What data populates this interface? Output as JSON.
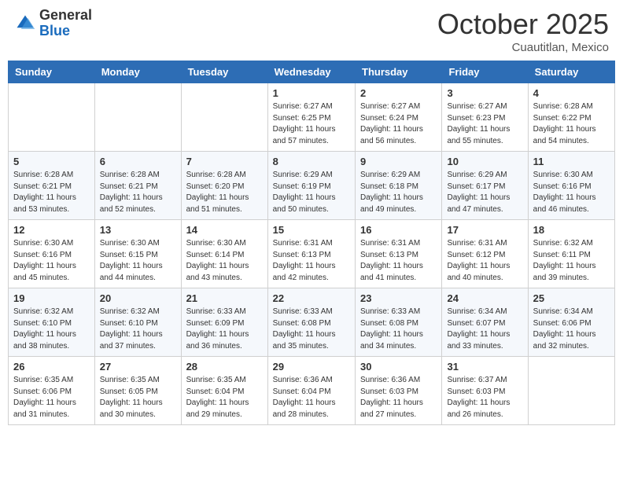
{
  "header": {
    "logo_general": "General",
    "logo_blue": "Blue",
    "month_title": "October 2025",
    "location": "Cuautitlan, Mexico"
  },
  "days_of_week": [
    "Sunday",
    "Monday",
    "Tuesday",
    "Wednesday",
    "Thursday",
    "Friday",
    "Saturday"
  ],
  "weeks": [
    [
      {
        "day": null
      },
      {
        "day": null
      },
      {
        "day": null
      },
      {
        "day": "1",
        "sunrise": "6:27 AM",
        "sunset": "6:25 PM",
        "daylight": "11 hours and 57 minutes."
      },
      {
        "day": "2",
        "sunrise": "6:27 AM",
        "sunset": "6:24 PM",
        "daylight": "11 hours and 56 minutes."
      },
      {
        "day": "3",
        "sunrise": "6:27 AM",
        "sunset": "6:23 PM",
        "daylight": "11 hours and 55 minutes."
      },
      {
        "day": "4",
        "sunrise": "6:28 AM",
        "sunset": "6:22 PM",
        "daylight": "11 hours and 54 minutes."
      }
    ],
    [
      {
        "day": "5",
        "sunrise": "6:28 AM",
        "sunset": "6:21 PM",
        "daylight": "11 hours and 53 minutes."
      },
      {
        "day": "6",
        "sunrise": "6:28 AM",
        "sunset": "6:21 PM",
        "daylight": "11 hours and 52 minutes."
      },
      {
        "day": "7",
        "sunrise": "6:28 AM",
        "sunset": "6:20 PM",
        "daylight": "11 hours and 51 minutes."
      },
      {
        "day": "8",
        "sunrise": "6:29 AM",
        "sunset": "6:19 PM",
        "daylight": "11 hours and 50 minutes."
      },
      {
        "day": "9",
        "sunrise": "6:29 AM",
        "sunset": "6:18 PM",
        "daylight": "11 hours and 49 minutes."
      },
      {
        "day": "10",
        "sunrise": "6:29 AM",
        "sunset": "6:17 PM",
        "daylight": "11 hours and 47 minutes."
      },
      {
        "day": "11",
        "sunrise": "6:30 AM",
        "sunset": "6:16 PM",
        "daylight": "11 hours and 46 minutes."
      }
    ],
    [
      {
        "day": "12",
        "sunrise": "6:30 AM",
        "sunset": "6:16 PM",
        "daylight": "11 hours and 45 minutes."
      },
      {
        "day": "13",
        "sunrise": "6:30 AM",
        "sunset": "6:15 PM",
        "daylight": "11 hours and 44 minutes."
      },
      {
        "day": "14",
        "sunrise": "6:30 AM",
        "sunset": "6:14 PM",
        "daylight": "11 hours and 43 minutes."
      },
      {
        "day": "15",
        "sunrise": "6:31 AM",
        "sunset": "6:13 PM",
        "daylight": "11 hours and 42 minutes."
      },
      {
        "day": "16",
        "sunrise": "6:31 AM",
        "sunset": "6:13 PM",
        "daylight": "11 hours and 41 minutes."
      },
      {
        "day": "17",
        "sunrise": "6:31 AM",
        "sunset": "6:12 PM",
        "daylight": "11 hours and 40 minutes."
      },
      {
        "day": "18",
        "sunrise": "6:32 AM",
        "sunset": "6:11 PM",
        "daylight": "11 hours and 39 minutes."
      }
    ],
    [
      {
        "day": "19",
        "sunrise": "6:32 AM",
        "sunset": "6:10 PM",
        "daylight": "11 hours and 38 minutes."
      },
      {
        "day": "20",
        "sunrise": "6:32 AM",
        "sunset": "6:10 PM",
        "daylight": "11 hours and 37 minutes."
      },
      {
        "day": "21",
        "sunrise": "6:33 AM",
        "sunset": "6:09 PM",
        "daylight": "11 hours and 36 minutes."
      },
      {
        "day": "22",
        "sunrise": "6:33 AM",
        "sunset": "6:08 PM",
        "daylight": "11 hours and 35 minutes."
      },
      {
        "day": "23",
        "sunrise": "6:33 AM",
        "sunset": "6:08 PM",
        "daylight": "11 hours and 34 minutes."
      },
      {
        "day": "24",
        "sunrise": "6:34 AM",
        "sunset": "6:07 PM",
        "daylight": "11 hours and 33 minutes."
      },
      {
        "day": "25",
        "sunrise": "6:34 AM",
        "sunset": "6:06 PM",
        "daylight": "11 hours and 32 minutes."
      }
    ],
    [
      {
        "day": "26",
        "sunrise": "6:35 AM",
        "sunset": "6:06 PM",
        "daylight": "11 hours and 31 minutes."
      },
      {
        "day": "27",
        "sunrise": "6:35 AM",
        "sunset": "6:05 PM",
        "daylight": "11 hours and 30 minutes."
      },
      {
        "day": "28",
        "sunrise": "6:35 AM",
        "sunset": "6:04 PM",
        "daylight": "11 hours and 29 minutes."
      },
      {
        "day": "29",
        "sunrise": "6:36 AM",
        "sunset": "6:04 PM",
        "daylight": "11 hours and 28 minutes."
      },
      {
        "day": "30",
        "sunrise": "6:36 AM",
        "sunset": "6:03 PM",
        "daylight": "11 hours and 27 minutes."
      },
      {
        "day": "31",
        "sunrise": "6:37 AM",
        "sunset": "6:03 PM",
        "daylight": "11 hours and 26 minutes."
      },
      {
        "day": null
      }
    ]
  ],
  "labels": {
    "sunrise_prefix": "Sunrise: ",
    "sunset_prefix": "Sunset: ",
    "daylight_prefix": "Daylight: "
  }
}
